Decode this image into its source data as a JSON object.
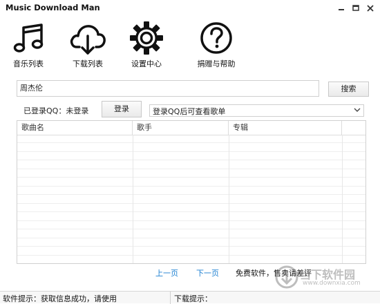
{
  "window": {
    "title": "Music Download Man"
  },
  "toolbar": {
    "items": [
      {
        "label": "音乐列表",
        "icon": "music-note-icon"
      },
      {
        "label": "下载列表",
        "icon": "cloud-download-icon"
      },
      {
        "label": "设置中心",
        "icon": "gear-icon"
      },
      {
        "label": "捐赠与帮助",
        "icon": "help-circle-icon"
      }
    ]
  },
  "search": {
    "value": "周杰伦",
    "button_label": "搜索"
  },
  "login": {
    "status_text": "已登录QQ：未登录",
    "button_label": "登录",
    "playlist_select": "登录QQ后可查看歌单"
  },
  "table": {
    "columns": [
      "歌曲名",
      "歌手",
      "专辑"
    ],
    "rows": []
  },
  "pagination": {
    "prev_label": "上一页",
    "next_label": "下一页",
    "notice": "免费软件，售卖请差评"
  },
  "statusbar": {
    "tip": "软件提示：获取信息成功，请使用",
    "download_tip": "下载提示："
  },
  "watermark": {
    "brand": "当下软件园",
    "url": "www.downxia.com"
  },
  "colors": {
    "link": "#1b7fd1"
  }
}
